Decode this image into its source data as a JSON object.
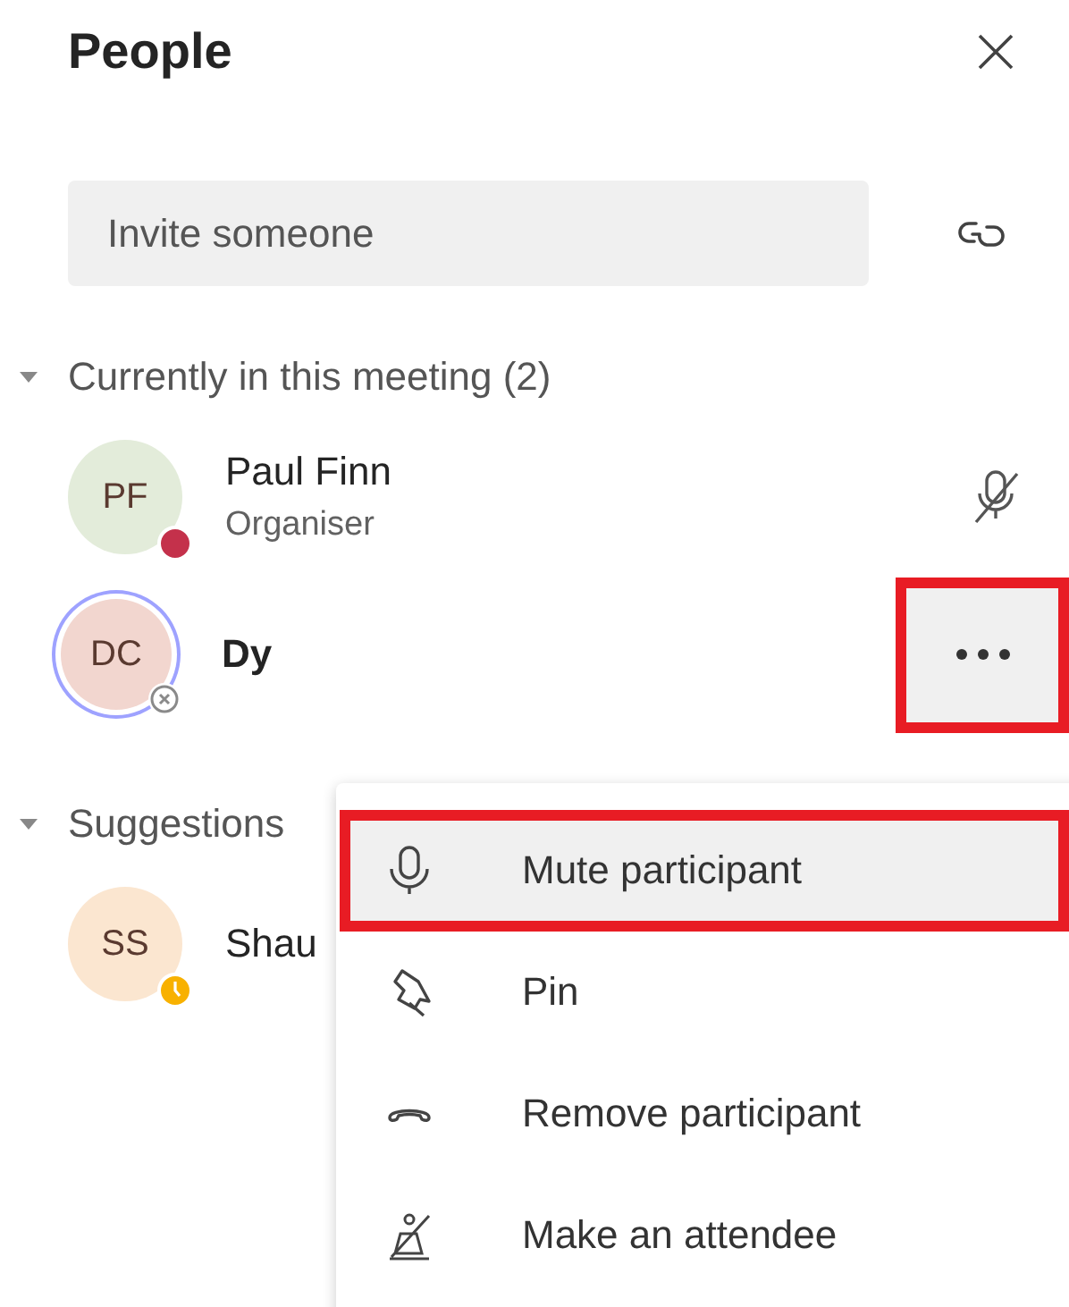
{
  "panel": {
    "title": "People"
  },
  "invite": {
    "placeholder": "Invite someone"
  },
  "sections": [
    {
      "title": "Currently in this meeting (2)",
      "expanded": true,
      "people": [
        {
          "initials": "PF",
          "name": "Paul Finn",
          "role": "Organiser",
          "kind": "busy",
          "color": "#e3ecda",
          "ring": false,
          "bold": false,
          "trailing": {
            "kind": "mic-off"
          }
        },
        {
          "initials": "DC",
          "name": "Dy",
          "kind": "offline",
          "color": "#f2d6cf",
          "ring": true,
          "bold": true,
          "trailing": {
            "kind": "more"
          }
        }
      ]
    },
    {
      "title": "Suggestions",
      "expanded": true,
      "people": [
        {
          "initials": "SS",
          "name": "Shau",
          "kind": "away",
          "color": "#fbe6d0",
          "ring": false,
          "bold": false
        }
      ]
    }
  ],
  "more_button": {
    "annotated": true
  },
  "menu": {
    "items": [
      {
        "label": "Mute participant",
        "kind": "mic",
        "highlighted": true
      },
      {
        "label": "Pin",
        "kind": "pin",
        "highlighted": false
      },
      {
        "label": "Remove participant",
        "kind": "hangup",
        "highlighted": false
      },
      {
        "label": "Make an attendee",
        "kind": "attendee",
        "highlighted": false
      }
    ]
  }
}
